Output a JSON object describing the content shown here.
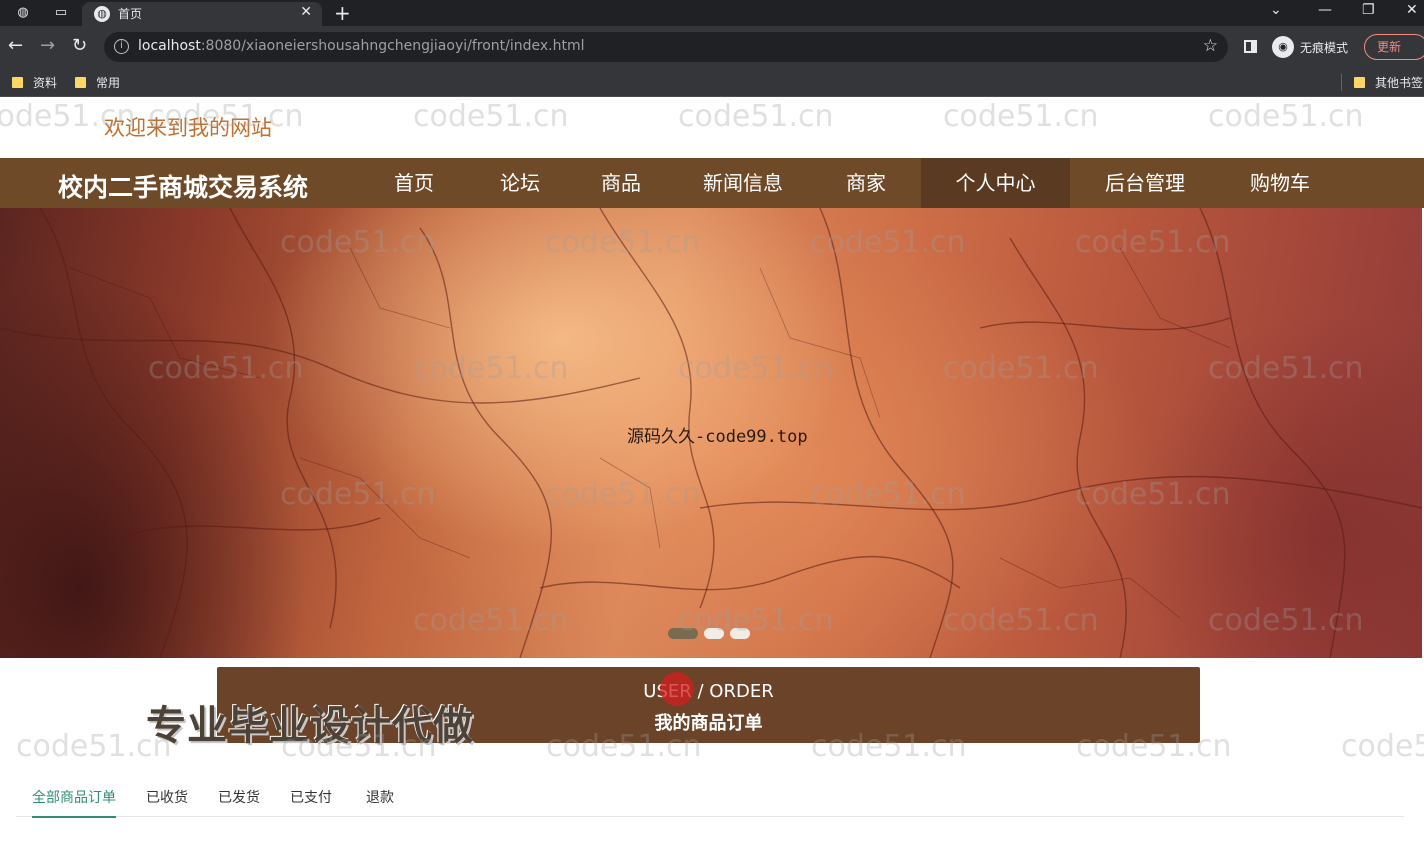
{
  "browser": {
    "tab_title": "首页",
    "url_host": "localhost",
    "url_path": ":8080/xiaoneiershousahngchengjiaoyi/front/index.html",
    "incognito_label": "无痕模式",
    "update_label": "更新",
    "bookmarks": [
      "资料",
      "常用"
    ],
    "other_bookmarks": "其他书签"
  },
  "header": {
    "welcome": "欢迎来到我的网站"
  },
  "nav": {
    "site_title": "校内二手商城交易系统",
    "items": [
      "首页",
      "论坛",
      "商品",
      "新闻信息",
      "商家",
      "个人中心",
      "后台管理",
      "购物车"
    ],
    "active": "个人中心"
  },
  "banner": {
    "caption": "源码久久-code99.top",
    "slide_count": 3,
    "active_slide": 1
  },
  "section": {
    "title_en_a": "USER",
    "title_en_sep": " / ",
    "title_en_b": "ORDER",
    "title_cn": "我的商品订单"
  },
  "promo_overlay": "专业毕业设计代做",
  "order_tabs": [
    "全部商品订单",
    "已收货",
    "已发货",
    "已支付",
    "退款"
  ],
  "active_order_tab": "全部商品订单",
  "watermark": "code51.cn",
  "colors": {
    "nav_bg": "#6f4a29",
    "nav_active": "#5a3a21",
    "section_bg": "#6b4328",
    "welcome_text": "#c0702f",
    "tab_active": "#2f8f6f"
  }
}
